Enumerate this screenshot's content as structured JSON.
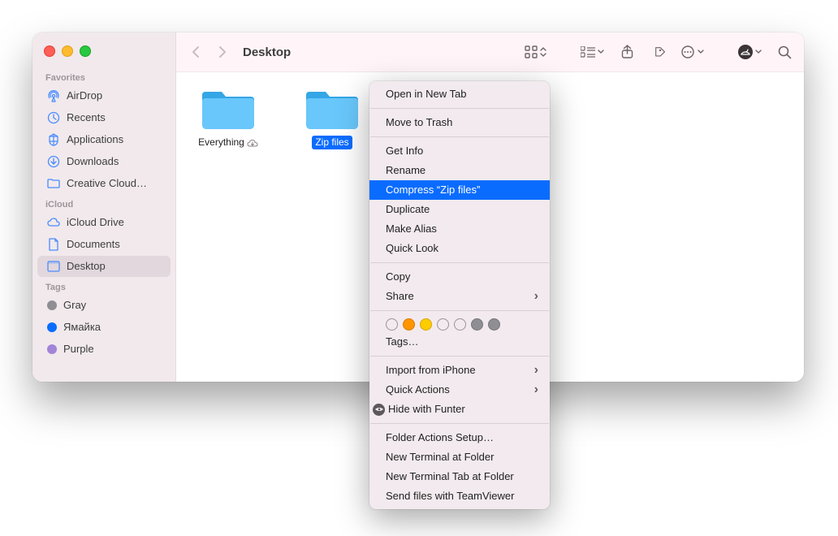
{
  "window_title": "Desktop",
  "sidebar": {
    "sections": [
      {
        "label": "Favorites",
        "items": [
          {
            "id": "airdrop",
            "label": "AirDrop",
            "icon": "airdrop"
          },
          {
            "id": "recents",
            "label": "Recents",
            "icon": "clock"
          },
          {
            "id": "applications",
            "label": "Applications",
            "icon": "apps"
          },
          {
            "id": "downloads",
            "label": "Downloads",
            "icon": "download"
          },
          {
            "id": "creativecloud",
            "label": "Creative Cloud…",
            "icon": "folder"
          }
        ]
      },
      {
        "label": "iCloud",
        "items": [
          {
            "id": "iclouddrive",
            "label": "iCloud Drive",
            "icon": "cloud"
          },
          {
            "id": "documents",
            "label": "Documents",
            "icon": "doc"
          },
          {
            "id": "desktop",
            "label": "Desktop",
            "icon": "desktop",
            "selected": true
          }
        ]
      },
      {
        "label": "Tags",
        "items": [
          {
            "id": "tag-gray",
            "label": "Gray",
            "color": "#8e8e93"
          },
          {
            "id": "tag-jamaica",
            "label": "Ямайка",
            "color": "#0a6cff"
          },
          {
            "id": "tag-purple",
            "label": "Purple",
            "color": "#a284d8"
          }
        ]
      }
    ]
  },
  "files": [
    {
      "name": "Everything",
      "selected": false,
      "cloud": true
    },
    {
      "name": "Zip files",
      "selected": true,
      "cloud": false
    }
  ],
  "context_menu": {
    "groups": [
      [
        {
          "label": "Open in New Tab"
        }
      ],
      [
        {
          "label": "Move to Trash"
        }
      ],
      [
        {
          "label": "Get Info"
        },
        {
          "label": "Rename"
        },
        {
          "label": "Compress “Zip files”",
          "highlight": true
        },
        {
          "label": "Duplicate"
        },
        {
          "label": "Make Alias"
        },
        {
          "label": "Quick Look"
        }
      ],
      [
        {
          "label": "Copy"
        },
        {
          "label": "Share",
          "submenu": true
        }
      ],
      "colors",
      [
        {
          "label": "Import from iPhone",
          "submenu": true
        },
        {
          "label": "Quick Actions",
          "submenu": true
        },
        {
          "label": "Hide with Funter",
          "icon": "funter"
        }
      ],
      [
        {
          "label": "Folder Actions Setup…"
        },
        {
          "label": "New Terminal at Folder"
        },
        {
          "label": "New Terminal Tab at Folder"
        },
        {
          "label": "Send files with TeamViewer"
        }
      ]
    ],
    "tags_label": "Tags…",
    "colors": [
      {
        "fill": "none",
        "stroke": "#9a9298"
      },
      {
        "fill": "#ff9500",
        "stroke": "#d97b00"
      },
      {
        "fill": "#ffcc00",
        "stroke": "#d6a800"
      },
      {
        "fill": "none",
        "stroke": "#9a9298"
      },
      {
        "fill": "none",
        "stroke": "#9a9298"
      },
      {
        "fill": "#8e8e93",
        "stroke": "#76767b"
      },
      {
        "fill": "#8e8e93",
        "stroke": "#76767b"
      }
    ]
  }
}
